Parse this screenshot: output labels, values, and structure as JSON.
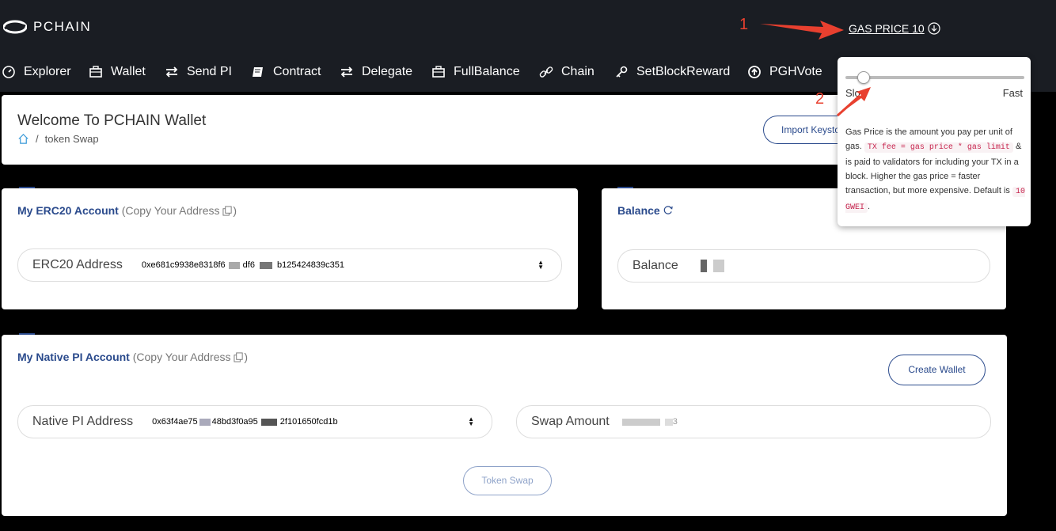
{
  "header": {
    "brand": "PCHAIN",
    "gas_price_label": "GAS PRICE 10"
  },
  "nav": {
    "items": [
      {
        "label": "Explorer",
        "icon": "gauge-icon"
      },
      {
        "label": "Wallet",
        "icon": "briefcase-icon"
      },
      {
        "label": "Send PI",
        "icon": "exchange-icon"
      },
      {
        "label": "Contract",
        "icon": "book-icon"
      },
      {
        "label": "Delegate",
        "icon": "exchange-icon"
      },
      {
        "label": "FullBalance",
        "icon": "briefcase-icon"
      },
      {
        "label": "Chain",
        "icon": "link-icon"
      },
      {
        "label": "SetBlockReward",
        "icon": "key-icon"
      },
      {
        "label": "PGHVote",
        "icon": "circle-arrow-icon"
      }
    ]
  },
  "welcome": {
    "title": "Welcome To PCHAIN Wallet",
    "breadcrumb_sep": "/",
    "breadcrumb_page": "token Swap",
    "import_button": "Import Keysto"
  },
  "erc20": {
    "heading": "My ERC20 Account",
    "copy_text": "(Copy Your Address",
    "copy_close": ")",
    "address_label": "ERC20 Address",
    "address_start": "0xe681c9938e8318f6",
    "address_mid": "df6",
    "address_end": "b125424839c351"
  },
  "balance": {
    "heading": "Balance",
    "label": "Balance"
  },
  "native": {
    "heading": "My Native PI Account",
    "copy_text": "(Copy Your Address",
    "copy_close": ")",
    "create_button": "Create Wallet",
    "address_label": "Native PI Address",
    "address_start": "0x63f4ae75",
    "address_mid": "48bd3f0a95",
    "address_end": "2f101650fcd1b",
    "swap_label": "Swap Amount",
    "swap_value_end": "3",
    "swap_button": "Token Swap"
  },
  "popover": {
    "slider_level": 0.1,
    "slow_label": "Slow",
    "fast_label": "Fast",
    "text_1": "Gas Price is the amount you pay per unit of gas.",
    "code_1": "TX fee = gas price * gas limit",
    "text_2": "& is paid to validators for including your TX in a block. Higher the gas price = faster transaction, but more expensive. Default is",
    "code_2": "10 GWEI",
    "text_3": "."
  },
  "annotations": {
    "one": "1",
    "two": "2",
    "arrow_color": "#e8402f"
  },
  "colors": {
    "header_bg": "#1a1d23",
    "accent": "#2a4a8c",
    "page_bg": "#000000"
  }
}
